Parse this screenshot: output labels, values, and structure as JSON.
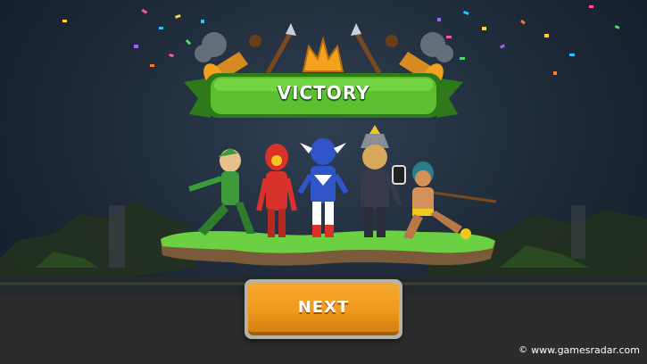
{
  "result": {
    "banner_text": "VICTORY"
  },
  "actions": {
    "next_label": "NEXT"
  },
  "watermark": {
    "text": "www.gamesradar.com",
    "icon": "copyright-icon"
  },
  "heroes": [
    {
      "name": "green-archer-hero",
      "color": "#3e9b3a"
    },
    {
      "name": "red-flash-hero",
      "color": "#d8322a"
    },
    {
      "name": "blue-captain-hero",
      "color": "#2f55c8"
    },
    {
      "name": "dark-viking-hero",
      "color": "#363a4a"
    },
    {
      "name": "tribal-warrior-hero",
      "color": "#d5915a"
    }
  ],
  "colors": {
    "banner_green": "#5bbf2f",
    "banner_dark_green": "#2e7a1b",
    "crown_gold": "#f2a21c",
    "button_orange": "#f09a1e",
    "platform_grass": "#6cd043"
  }
}
